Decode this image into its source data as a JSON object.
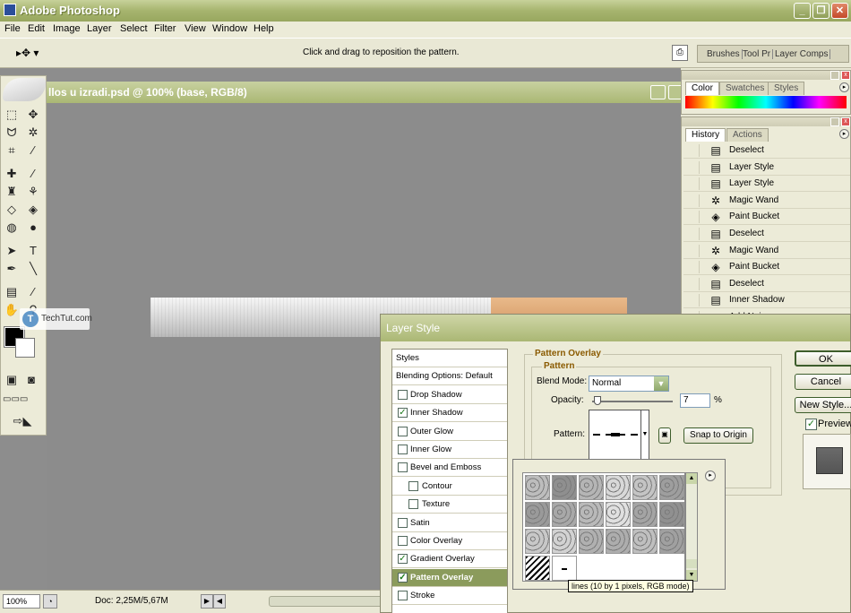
{
  "app": {
    "title": "Adobe Photoshop"
  },
  "menu": [
    "File",
    "Edit",
    "Image",
    "Layer",
    "Select",
    "Filter",
    "View",
    "Window",
    "Help"
  ],
  "options": {
    "hint": "Click and drag to reposition the pattern.",
    "wells": [
      "Brushes",
      "Tool Pr",
      "Layer Comps"
    ]
  },
  "document": {
    "title": "llos u izradi.psd @ 100% (base, RGB/8)"
  },
  "status": {
    "zoom": "100%",
    "doc": "Doc: 2,25M/5,67M"
  },
  "watermark": {
    "text": "TechTut.com"
  },
  "color_palette": {
    "tabs": [
      "Color",
      "Swatches",
      "Styles"
    ]
  },
  "history_palette": {
    "tabs": [
      "History",
      "Actions"
    ],
    "items": [
      {
        "label": "Deselect",
        "icon": "document-icon"
      },
      {
        "label": "Layer Style",
        "icon": "document-icon"
      },
      {
        "label": "Layer Style",
        "icon": "document-icon"
      },
      {
        "label": "Magic Wand",
        "icon": "magic-wand-icon"
      },
      {
        "label": "Paint Bucket",
        "icon": "paint-bucket-icon"
      },
      {
        "label": "Deselect",
        "icon": "document-icon"
      },
      {
        "label": "Magic Wand",
        "icon": "magic-wand-icon"
      },
      {
        "label": "Paint Bucket",
        "icon": "paint-bucket-icon"
      },
      {
        "label": "Deselect",
        "icon": "document-icon"
      },
      {
        "label": "Inner Shadow",
        "icon": "document-icon"
      },
      {
        "label": "Add Noise",
        "icon": "document-icon"
      }
    ]
  },
  "dialog": {
    "title": "Layer Style",
    "styles": [
      {
        "label": "Styles",
        "checkbox": false
      },
      {
        "label": "Blending Options: Default",
        "checkbox": false
      },
      {
        "label": "Drop Shadow",
        "checkbox": true,
        "checked": false
      },
      {
        "label": "Inner Shadow",
        "checkbox": true,
        "checked": true
      },
      {
        "label": "Outer Glow",
        "checkbox": true,
        "checked": false
      },
      {
        "label": "Inner Glow",
        "checkbox": true,
        "checked": false
      },
      {
        "label": "Bevel and Emboss",
        "checkbox": true,
        "checked": false
      },
      {
        "label": "Contour",
        "checkbox": true,
        "checked": false,
        "indent": true
      },
      {
        "label": "Texture",
        "checkbox": true,
        "checked": false,
        "indent": true
      },
      {
        "label": "Satin",
        "checkbox": true,
        "checked": false
      },
      {
        "label": "Color Overlay",
        "checkbox": true,
        "checked": false
      },
      {
        "label": "Gradient Overlay",
        "checkbox": true,
        "checked": true
      },
      {
        "label": "Pattern Overlay",
        "checkbox": true,
        "checked": true,
        "selected": true
      },
      {
        "label": "Stroke",
        "checkbox": true,
        "checked": false
      }
    ],
    "section_title": "Pattern Overlay",
    "group_title": "Pattern",
    "blend_mode_label": "Blend Mode:",
    "blend_mode_value": "Normal",
    "opacity_label": "Opacity:",
    "opacity_value": "7",
    "opacity_percent": 7,
    "opacity_unit": "%",
    "pattern_label": "Pattern:",
    "snap_button": "Snap to Origin",
    "buttons": {
      "ok": "OK",
      "cancel": "Cancel",
      "new_style": "New Style...",
      "preview": "Preview"
    },
    "preview_checked": true
  },
  "picker": {
    "tooltip": "lines (10 by 1 pixels, RGB mode)"
  }
}
